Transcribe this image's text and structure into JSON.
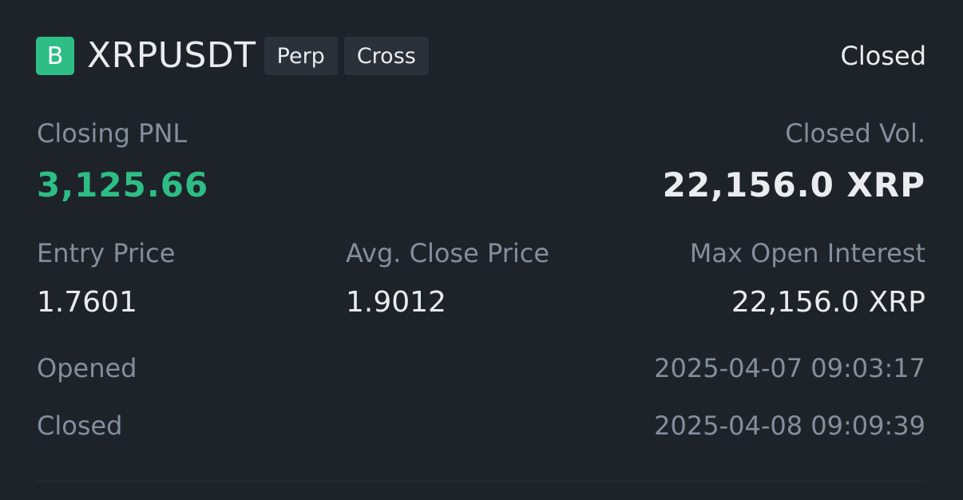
{
  "header": {
    "side_badge": "B",
    "symbol": "XRPUSDT",
    "tags": [
      "Perp",
      "Cross"
    ],
    "status": "Closed"
  },
  "summary": {
    "closing_pnl_label": "Closing PNL",
    "closing_pnl_value": "3,125.66",
    "closed_vol_label": "Closed Vol.",
    "closed_vol_value": "22,156.0 XRP"
  },
  "details": {
    "entry_price_label": "Entry Price",
    "entry_price_value": "1.7601",
    "avg_close_price_label": "Avg. Close Price",
    "avg_close_price_value": "1.9012",
    "max_open_interest_label": "Max Open Interest",
    "max_open_interest_value": "22,156.0 XRP"
  },
  "times": {
    "opened_label": "Opened",
    "opened_value": "2025-04-07 09:03:17",
    "closed_label": "Closed",
    "closed_value": "2025-04-08 09:09:39"
  },
  "colors": {
    "background": "#1e2329",
    "profit_green": "#2ebd85",
    "primary_text": "#eaecef",
    "secondary_text": "#848e9c",
    "tag_background": "#2b3139"
  }
}
